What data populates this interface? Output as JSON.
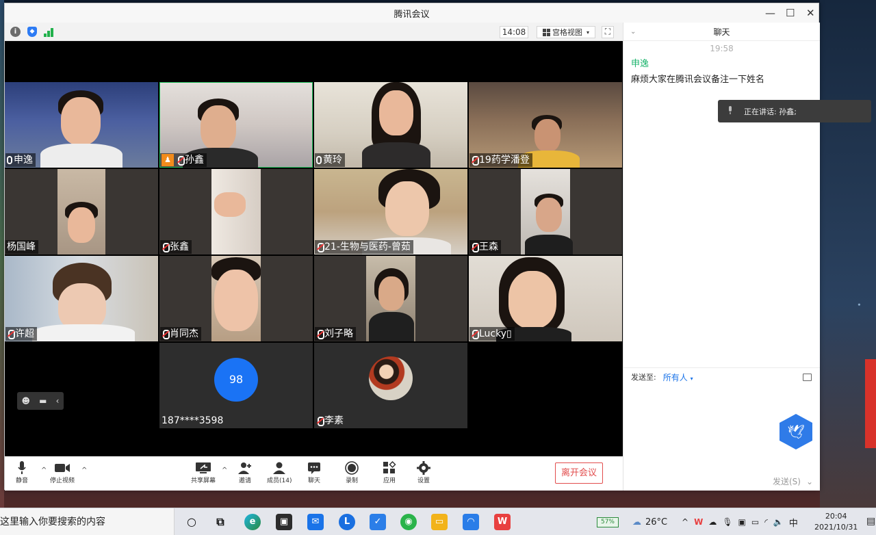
{
  "window": {
    "title": "腾讯会议",
    "controls": {
      "minimize": "—",
      "maximize": "☐",
      "close": "✕"
    }
  },
  "topbar": {
    "time": "14:08",
    "view_label": "宫格视图",
    "view_caret": "▾",
    "info_glyph": "i",
    "shield_glyph": "◆"
  },
  "tiles": [
    {
      "name": "申逸",
      "mic": "on",
      "bg": "#3a4a7a"
    },
    {
      "name": "孙鑫",
      "mic": "off",
      "host": true,
      "active": true,
      "bg": "#cfcac4"
    },
    {
      "name": "黄玲",
      "mic": "on",
      "bg": "#d9d3c8"
    },
    {
      "name": "19药学潘登",
      "mic": "off",
      "bg": "#6b5a4a"
    },
    {
      "name": "杨国峰",
      "mic": "none",
      "bg": "#3a3633"
    },
    {
      "name": "张鑫",
      "mic": "off",
      "bg": "#3a3633"
    },
    {
      "name": "21-生物与医药-曾茹",
      "mic": "off",
      "bg": "#cdb89a"
    },
    {
      "name": "王森",
      "mic": "off",
      "bg": "#3a3633"
    },
    {
      "name": "许超",
      "mic": "off",
      "bg": "#bcc6d2"
    },
    {
      "name": "肖同杰",
      "mic": "off",
      "bg": "#3a3633"
    },
    {
      "name": "刘子略",
      "mic": "off",
      "bg": "#3a3633"
    },
    {
      "name": "Lucky▯",
      "mic": "off",
      "bg": "#d8d2c6"
    },
    {
      "name": "187****3598",
      "mic": "none",
      "avatar_text": "98",
      "bg": "#2b2b2b"
    },
    {
      "name": "李素",
      "mic": "off",
      "avatar": "photo",
      "bg": "#2b2b2b"
    }
  ],
  "float_controls": {
    "emoji": "☻",
    "chat": "▬",
    "collapse": "‹"
  },
  "toolbar": {
    "mute": "静音",
    "stop_video": "停止视频",
    "share_screen": "共享屏幕",
    "invite": "邀请",
    "members": "成员(14)",
    "chat": "聊天",
    "record": "录制",
    "apps": "应用",
    "settings": "设置",
    "leave": "离开会议",
    "caret": "^"
  },
  "chat": {
    "title": "聊天",
    "collapse": "⌄",
    "time": "19:58",
    "sender": "申逸",
    "message": "麻烦大家在腾讯会议备注一下姓名",
    "speaking": "正在讲话: 孙鑫;",
    "send_to_label": "发送至:",
    "send_to_target": "所有人",
    "send_to_caret": "▾",
    "send_button": "发送(S)",
    "send_caret": "⌄"
  },
  "taskbar": {
    "search_placeholder": "这里输入你要搜索的内容",
    "battery": "57%",
    "temperature": "26°C",
    "ime": "中",
    "clock_time": "20:04",
    "clock_date": "2021/10/31"
  }
}
